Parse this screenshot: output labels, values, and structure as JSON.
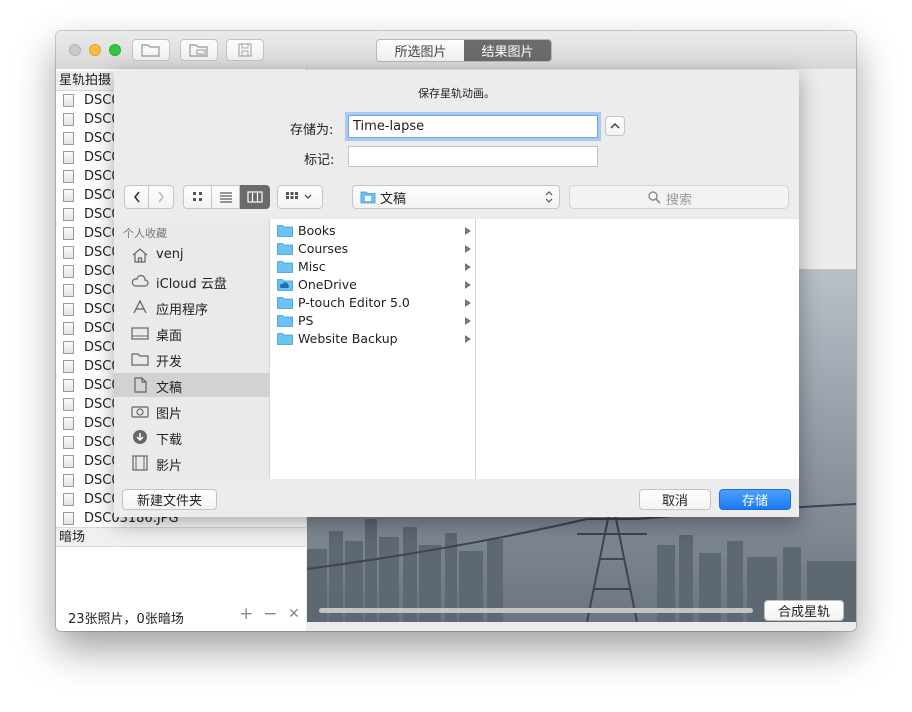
{
  "toolbar": {
    "segment_selected_photos": "所选图片",
    "segment_result_photos": "结果图片"
  },
  "left_panel": {
    "star_trails_header": "星轨拍摄",
    "file_prefix": "DSC0",
    "last_file": "DSC03186.JPG",
    "dark_frames_header": "暗场",
    "status": "23张照片，0张暗场",
    "add_symbol": "+",
    "remove_symbol": "−",
    "clear_symbol": "✕"
  },
  "right_panel": {
    "make_button": "合成星轨",
    "progress": 0
  },
  "save_sheet": {
    "message": "保存星轨动画。",
    "save_as_label": "存储为:",
    "save_as_value": "Time-lapse",
    "tags_label": "标记:",
    "tags_value": "",
    "location": "文稿",
    "search_placeholder": "搜索",
    "sidebar_header": "个人收藏",
    "sidebar_items": [
      {
        "label": "venj",
        "icon": "home-icon"
      },
      {
        "label": "iCloud 云盘",
        "icon": "cloud-icon"
      },
      {
        "label": "应用程序",
        "icon": "applications-icon"
      },
      {
        "label": "桌面",
        "icon": "desktop-icon"
      },
      {
        "label": "开发",
        "icon": "folder-icon"
      },
      {
        "label": "文稿",
        "icon": "documents-icon",
        "selected": true
      },
      {
        "label": "图片",
        "icon": "camera-icon"
      },
      {
        "label": "下载",
        "icon": "download-icon"
      },
      {
        "label": "影片",
        "icon": "film-icon"
      }
    ],
    "folders": [
      {
        "name": "Books"
      },
      {
        "name": "Courses"
      },
      {
        "name": "Misc"
      },
      {
        "name": "OneDrive"
      },
      {
        "name": "P-touch Editor 5.0"
      },
      {
        "name": "PS"
      },
      {
        "name": "Website Backup"
      }
    ],
    "new_folder_button": "新建文件夹",
    "cancel_button": "取消",
    "save_button": "存储"
  },
  "colors": {
    "accent": "#2f87f5",
    "folder_blue": "#6cc2f4",
    "selection_gray": "#d2d2d2"
  }
}
